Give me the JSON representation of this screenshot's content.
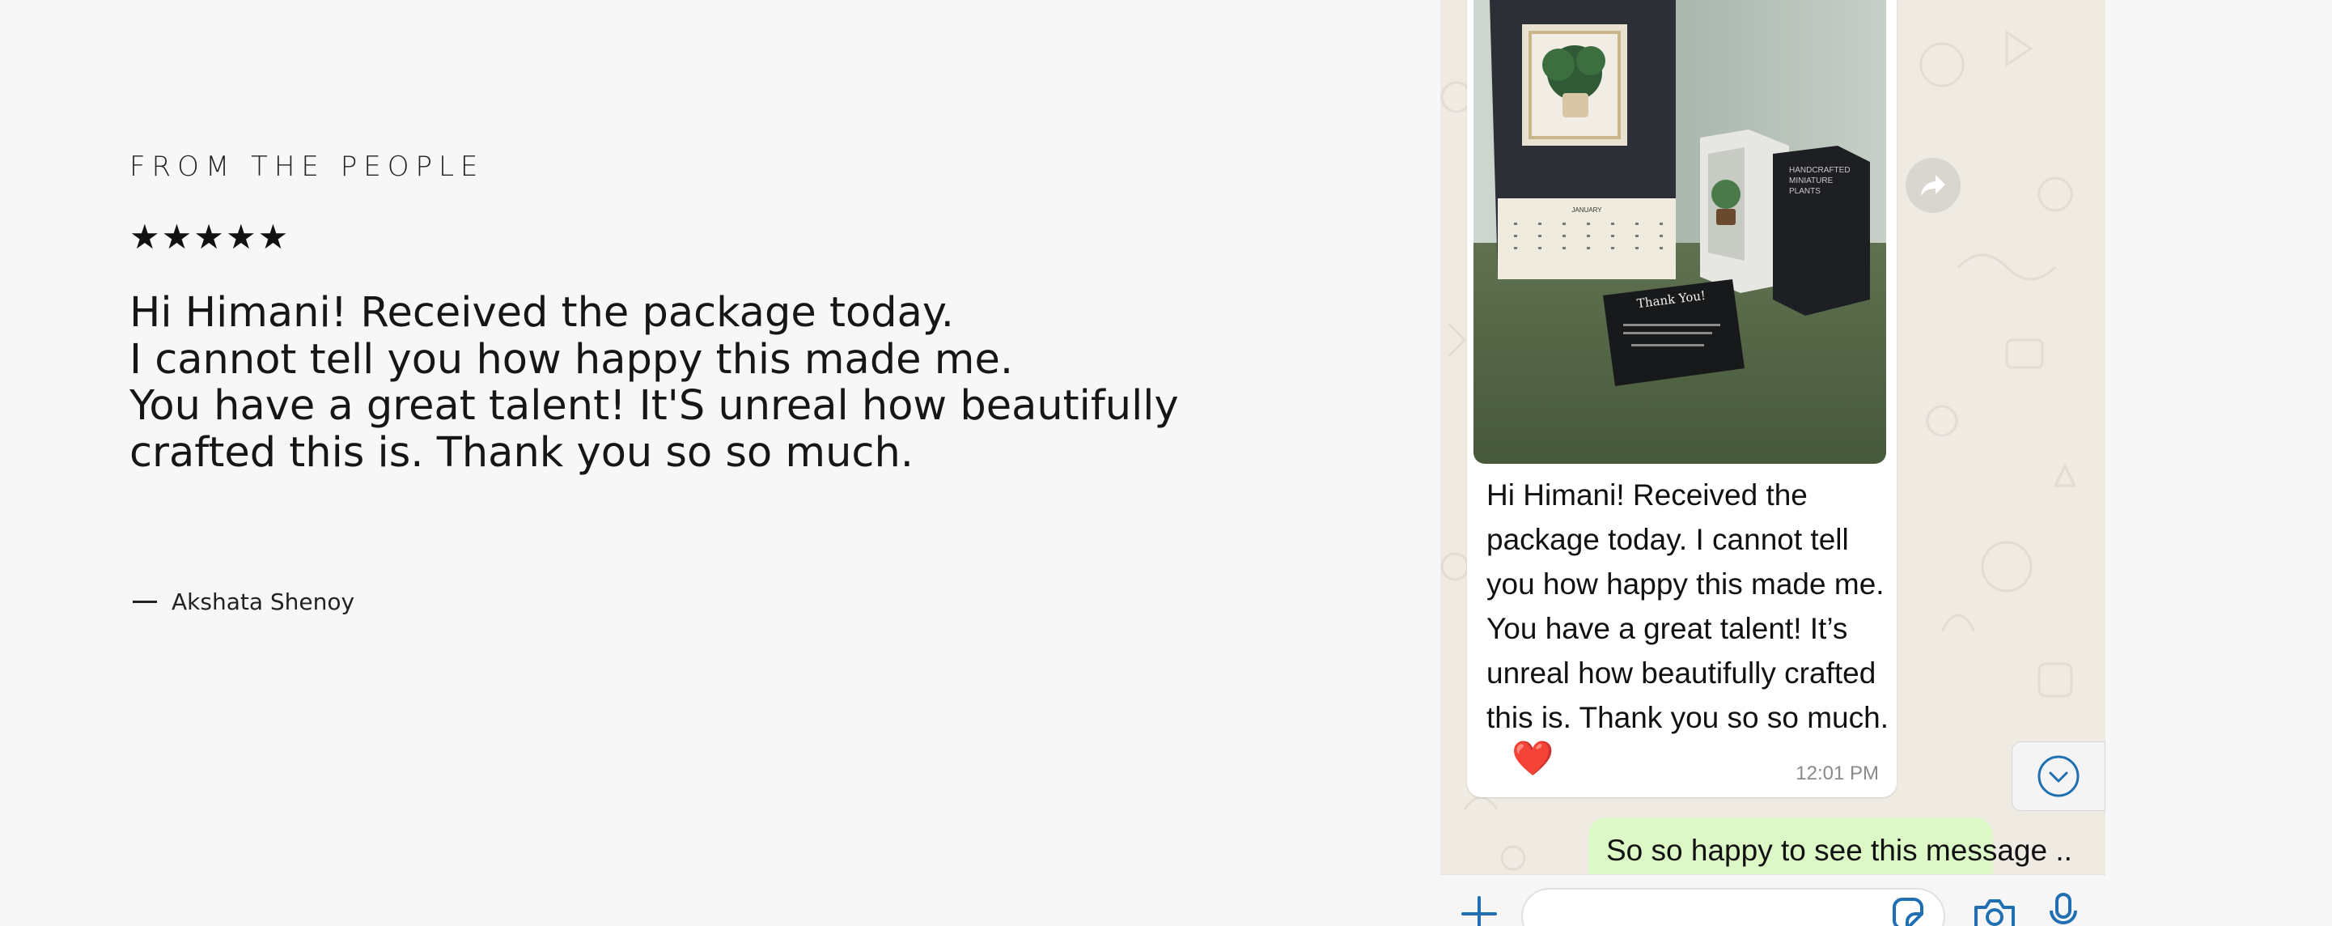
{
  "testimonial": {
    "kicker": "FROM THE PEOPLE",
    "stars": "★★★★★",
    "rating": 5,
    "quote_lines": [
      "Hi Himani! Received the package today.",
      "I cannot tell you how happy this made me.",
      "You have a great talent! It'S unreal how beautifully",
      "crafted this is. Thank you so so much."
    ],
    "author": "Akshata Shenoy"
  },
  "chat": {
    "received": {
      "text": "Hi Himani! Received the package today. I cannot tell you how happy this made me. You have a great talent! It’s unreal how beautifully crafted this is. Thank you so so much.",
      "reaction": "❤️",
      "time": "12:01 PM",
      "photo": {
        "calendar_month": "JANUARY",
        "card_title": "Thank You!",
        "box_label_line1": "HANDCRAFTED",
        "box_label_line2": "MINIATURE",
        "box_label_line3": "PLANTS"
      }
    },
    "sent": {
      "text": "So so happy to see this message .."
    },
    "icons": {
      "forward": "forward-arrow-icon",
      "scroll_down": "chevron-down-circle-icon",
      "plus": "plus-icon",
      "sticker": "sticker-icon",
      "camera": "camera-icon",
      "mic": "microphone-icon"
    },
    "colors": {
      "chat_bg": "#efeae2",
      "sent_bubble": "#dcf8c6",
      "accent_blue": "#1f6fb2"
    }
  }
}
